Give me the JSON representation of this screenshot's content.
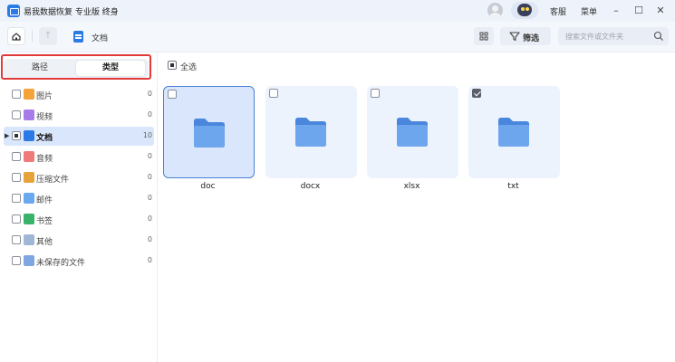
{
  "titlebar": {
    "app_title": "易我数据恢复 专业版 终身",
    "support_label": "客服",
    "menu_label": "菜单",
    "minimize_icon": "minimize-icon",
    "maximize_icon": "maximize-icon",
    "close_icon": "close-icon"
  },
  "toolbar": {
    "breadcrumb": "文档",
    "filter_label": "筛选",
    "search_placeholder": "搜索文件或文件夹"
  },
  "sidebar": {
    "tabs": [
      {
        "label": "路径",
        "active": false
      },
      {
        "label": "类型",
        "active": true
      }
    ],
    "categories": [
      {
        "label": "图片",
        "count": "0",
        "color": "#f5a43a"
      },
      {
        "label": "视频",
        "count": "0",
        "color": "#a77ce8"
      },
      {
        "label": "文档",
        "count": "10",
        "color": "#2b7be6",
        "selected": true
      },
      {
        "label": "音频",
        "count": "0",
        "color": "#f07a7a"
      },
      {
        "label": "压缩文件",
        "count": "0",
        "color": "#e8a23a"
      },
      {
        "label": "邮件",
        "count": "0",
        "color": "#6aa8f0"
      },
      {
        "label": "书签",
        "count": "0",
        "color": "#3ab36a"
      },
      {
        "label": "其他",
        "count": "0",
        "color": "#9fb6d6"
      },
      {
        "label": "未保存的文件",
        "count": "0",
        "color": "#7ea6e0"
      }
    ]
  },
  "main": {
    "select_all_label": "全选",
    "files": [
      {
        "name": "doc",
        "checked": false,
        "selected": true
      },
      {
        "name": "docx",
        "checked": false,
        "selected": false
      },
      {
        "name": "xlsx",
        "checked": false,
        "selected": false
      },
      {
        "name": "txt",
        "checked": true,
        "selected": false
      }
    ]
  },
  "colors": {
    "accent": "#2b7be6",
    "folder": "#5b9be8",
    "highlight_outline": "#e23a3a"
  }
}
